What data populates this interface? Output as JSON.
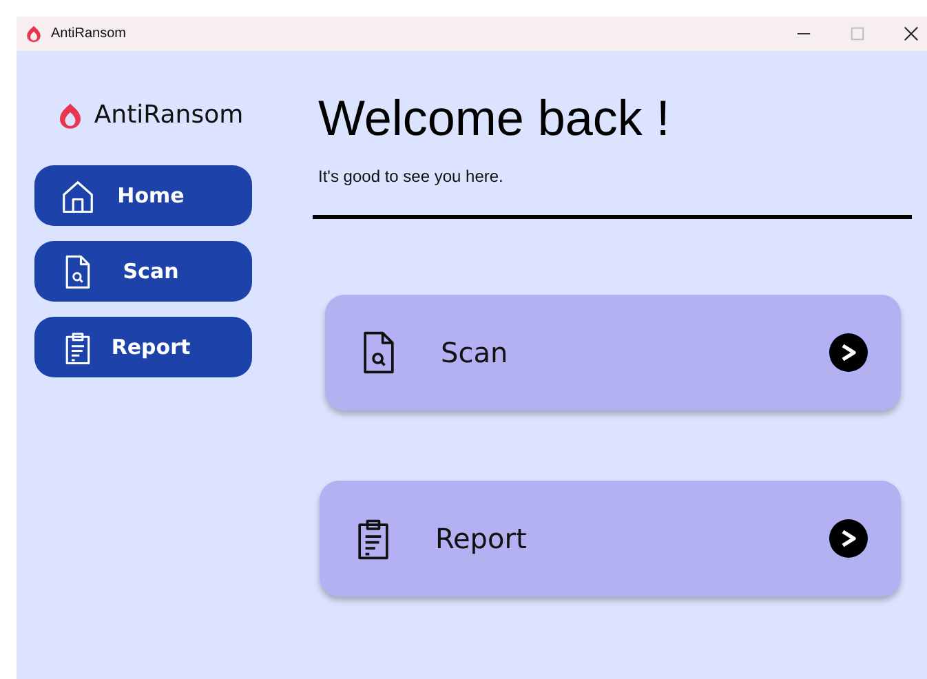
{
  "window": {
    "title": "AntiRansom"
  },
  "sidebar": {
    "brand": "AntiRansom",
    "items": [
      {
        "label": "Home",
        "kind": "home"
      },
      {
        "label": "Scan",
        "kind": "scan"
      },
      {
        "label": "Report",
        "kind": "report"
      }
    ]
  },
  "main": {
    "heading": "Welcome back !",
    "subtitle": "It's good to see you here.",
    "cards": [
      {
        "label": "Scan",
        "kind": "scan"
      },
      {
        "label": "Report",
        "kind": "report"
      }
    ]
  }
}
